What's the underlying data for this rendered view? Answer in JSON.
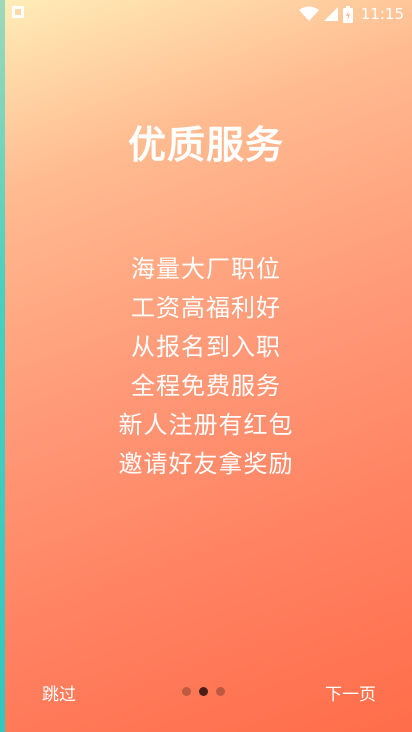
{
  "status_bar": {
    "time": "11:15",
    "icons": [
      "notification-icon",
      "wifi-icon",
      "cellular-signal-icon",
      "battery-icon"
    ]
  },
  "onboarding": {
    "title": "优质服务",
    "lines": [
      "海量大厂职位",
      "工资高福利好",
      "从报名到入职",
      "全程免费服务",
      "新人注册有红包",
      "邀请好友拿奖励"
    ],
    "skip_label": "跳过",
    "next_label": "下一页",
    "page_count": 3,
    "current_page": 2
  },
  "colors": {
    "gradient_top": "#ffedb8",
    "gradient_bottom": "#ff6d4a",
    "text": "#ffffff",
    "dot_active": "#4a1f17",
    "dot_inactive": "#9a4a36"
  }
}
